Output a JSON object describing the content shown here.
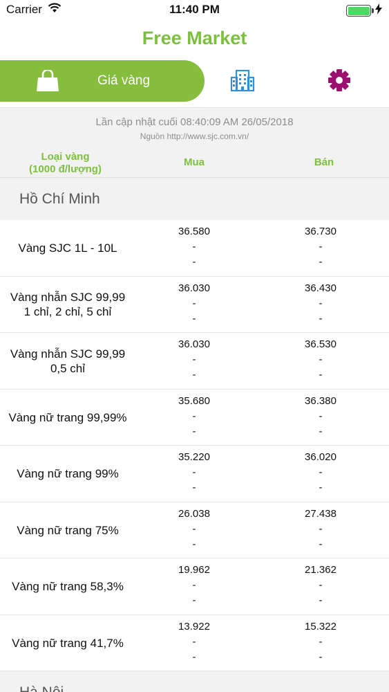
{
  "status_bar": {
    "carrier": "Carrier",
    "time": "11:40 PM"
  },
  "app": {
    "title": "Free Market"
  },
  "tabs": {
    "gold_label": "Giá vàng",
    "icons": [
      "shopping-bag-icon",
      "building-icon",
      "gear-icon"
    ],
    "accent_color": "#86bd3d",
    "gear_color": "#9c0f6e"
  },
  "info": {
    "updated": "Lần cập nhật cuối 08:40:09 AM 26/05/2018",
    "source": "Nguồn http://www.sjc.com.vn/"
  },
  "columns": {
    "type_line1": "Loại vàng",
    "type_line2": "(1000 đ/lượng)",
    "buy": "Mua",
    "sell": "Bán"
  },
  "sections": [
    {
      "name": "Hồ Chí Minh",
      "rows": [
        {
          "name": "Vàng SJC 1L - 10L",
          "buy": [
            "36.580",
            "-",
            "-"
          ],
          "sell": [
            "36.730",
            "-",
            "-"
          ]
        },
        {
          "name": "Vàng nhẫn SJC 99,99\n1 chỉ, 2 chỉ, 5 chỉ",
          "buy": [
            "36.030",
            "-",
            "-"
          ],
          "sell": [
            "36.430",
            "-",
            "-"
          ]
        },
        {
          "name": "Vàng nhẫn SJC 99,99\n0,5 chỉ",
          "buy": [
            "36.030",
            "-",
            "-"
          ],
          "sell": [
            "36.530",
            "-",
            "-"
          ]
        },
        {
          "name": "Vàng nữ trang 99,99%",
          "buy": [
            "35.680",
            "-",
            "-"
          ],
          "sell": [
            "36.380",
            "-",
            "-"
          ]
        },
        {
          "name": "Vàng nữ trang 99%",
          "buy": [
            "35.220",
            "-",
            "-"
          ],
          "sell": [
            "36.020",
            "-",
            "-"
          ]
        },
        {
          "name": "Vàng nữ trang 75%",
          "buy": [
            "26.038",
            "-",
            "-"
          ],
          "sell": [
            "27.438",
            "-",
            "-"
          ]
        },
        {
          "name": "Vàng nữ trang 58,3%",
          "buy": [
            "19.962",
            "-",
            "-"
          ],
          "sell": [
            "21.362",
            "-",
            "-"
          ]
        },
        {
          "name": "Vàng nữ trang 41,7%",
          "buy": [
            "13.922",
            "-",
            "-"
          ],
          "sell": [
            "15.322",
            "-",
            "-"
          ]
        }
      ]
    },
    {
      "name": "Hà Nội",
      "rows": []
    }
  ]
}
